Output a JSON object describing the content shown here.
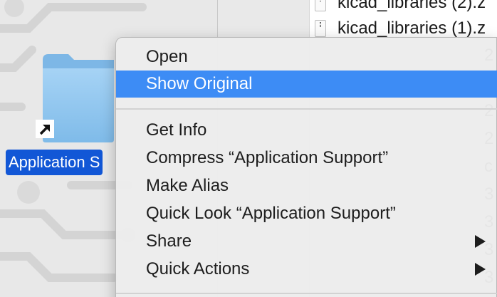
{
  "finder": {
    "files": [
      {
        "name": "kicad_libraries (2).z"
      },
      {
        "name": "kicad_libraries (1).z"
      }
    ],
    "partial_column_chars": [
      "2",
      "2",
      "2",
      "2",
      "c",
      "3",
      "3",
      "3",
      "3",
      "3",
      "3"
    ]
  },
  "desktop_item": {
    "label": "Application S",
    "icon": "folder-alias-icon"
  },
  "context_menu": {
    "items": [
      {
        "label": "Open"
      },
      {
        "label": "Show Original"
      },
      {
        "label": "Get Info"
      },
      {
        "label": "Compress “Application Support”"
      },
      {
        "label": "Make Alias"
      },
      {
        "label": "Quick Look “Application Support”"
      },
      {
        "label": "Share",
        "has_submenu": true
      },
      {
        "label": "Quick Actions",
        "has_submenu": true
      }
    ],
    "highlighted_item": "Show Original"
  },
  "colors": {
    "highlight": "#3d8cf5",
    "label_selection": "#1257d6",
    "folder": "#8fc4ee"
  }
}
